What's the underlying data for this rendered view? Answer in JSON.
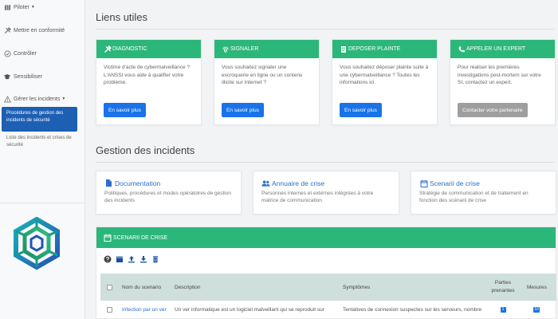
{
  "sidebar": {
    "items": [
      {
        "label": "Piloter",
        "icon": "map-icon"
      },
      {
        "label": "Mettre en conformité",
        "icon": "tools-icon"
      },
      {
        "label": "Contrôler",
        "icon": "check-circle-icon"
      },
      {
        "label": "Sensibiliser",
        "icon": "graduation-cap-icon"
      },
      {
        "label": "Gérer les incidents",
        "icon": "warning-icon"
      }
    ],
    "sub_active": "Procédures de gestion des incidents de sécurité",
    "sub_item": "Liste des incidents et crises de sécurité"
  },
  "liens": {
    "title": "Liens utiles",
    "cards": [
      {
        "title": "Diagnostic",
        "icon": "tools-icon",
        "text": "Victime d'acte de cybermalveillance ? L'ANSSI vous aide à qualifier votre problème.",
        "button": "En savoir plus"
      },
      {
        "title": "Signaler",
        "icon": "fingerprint-icon",
        "text": "Vous souhaitez signaler une escroquerie en ligne ou un contenu illicite sur Internet ?",
        "button": "En savoir plus"
      },
      {
        "title": "Deposer plainte",
        "icon": "document-icon",
        "text": "Vous souhaitez déposer plainte suite à une cybermalveillance ? Toutes les informations ici.",
        "button": "En savoir plus"
      },
      {
        "title": "Appeler un expert",
        "icon": "phone-icon",
        "text": "Pour réaliser les premières investigations post-mortem sur votre SI, contactez un expert.",
        "button": "Contacter votre partenaire"
      }
    ]
  },
  "gestion": {
    "title": "Gestion des incidents",
    "cards": [
      {
        "title": "Documentation",
        "icon": "file-icon",
        "text": "Politiques, procédures et modes opératoires de gestion des incidents"
      },
      {
        "title": "Annuaire de crise",
        "icon": "users-icon",
        "text": "Personnes internes et externes intégrées à votre matrice de communication"
      },
      {
        "title": "Scenarii de crise",
        "icon": "calendar-icon",
        "text": "Stratégie de communication et de traitement en fonction des scénarii de crise"
      }
    ]
  },
  "scenarii": {
    "header": "Scenarii de crise",
    "columns": {
      "name": "Nom du scenario",
      "description": "Description",
      "symptomes": "Symptômes",
      "parties": "Parties prenantes",
      "mesures": "Mesures"
    },
    "rows": [
      {
        "name": "Infection par un ver",
        "description": "Un ver informatique est un logiciel malveillant qui se reproduit sur",
        "symptomes": "Tentatives de connexion suspectes sur les serveurs, nombre",
        "parties": "1",
        "mesures": "10"
      }
    ]
  },
  "colors": {
    "green": "#2cb77a",
    "blue": "#1a73e8",
    "nav_active": "#1d5fb3"
  }
}
